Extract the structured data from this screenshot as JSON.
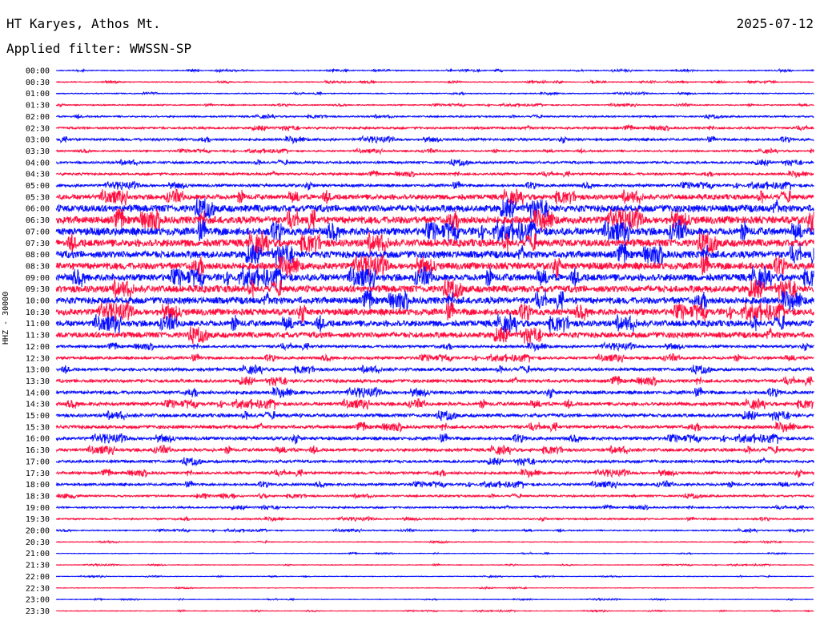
{
  "header": {
    "station": "HT Karyes, Athos Mt.",
    "filter": "Applied filter: WWSSN-SP",
    "date": "2025-07-12"
  },
  "axis_label": "HHZ - 30000",
  "colors": {
    "red": "#ff1040",
    "blue": "#0a10ff"
  },
  "chart_data": {
    "type": "line",
    "title": "HT Karyes, Athos Mt.",
    "ylabel": "HHZ - 30000",
    "row_labels": [
      "00:00",
      "00:30",
      "01:00",
      "01:30",
      "02:00",
      "02:30",
      "03:00",
      "03:30",
      "04:00",
      "04:30",
      "05:00",
      "05:30",
      "06:00",
      "06:30",
      "07:00",
      "07:30",
      "08:00",
      "08:30",
      "09:00",
      "09:30",
      "10:00",
      "10:30",
      "11:00",
      "11:30",
      "12:00",
      "12:30",
      "13:00",
      "13:30",
      "14:00",
      "14:30",
      "15:00",
      "15:30",
      "16:00",
      "16:30",
      "17:00",
      "17:30",
      "18:00",
      "18:30",
      "19:00",
      "19:30",
      "20:00",
      "20:30",
      "21:00",
      "21:30",
      "22:00",
      "22:30",
      "23:00",
      "23:30"
    ],
    "row_color_pattern": [
      "blue",
      "red"
    ],
    "noise_amplitude": [
      0.5,
      0.5,
      0.5,
      0.6,
      0.8,
      1.1,
      1.3,
      0.9,
      1.3,
      1.2,
      1.6,
      3.0,
      4.2,
      4.4,
      4.5,
      4.4,
      4.3,
      4.2,
      4.2,
      4.1,
      4.0,
      3.8,
      3.6,
      3.4,
      1.5,
      1.6,
      1.8,
      1.9,
      2.0,
      2.0,
      2.0,
      1.9,
      1.9,
      1.8,
      1.6,
      1.5,
      1.4,
      1.0,
      0.9,
      0.8,
      0.6,
      0.4,
      0.3,
      0.3,
      0.3,
      0.3,
      0.3,
      0.3
    ]
  }
}
